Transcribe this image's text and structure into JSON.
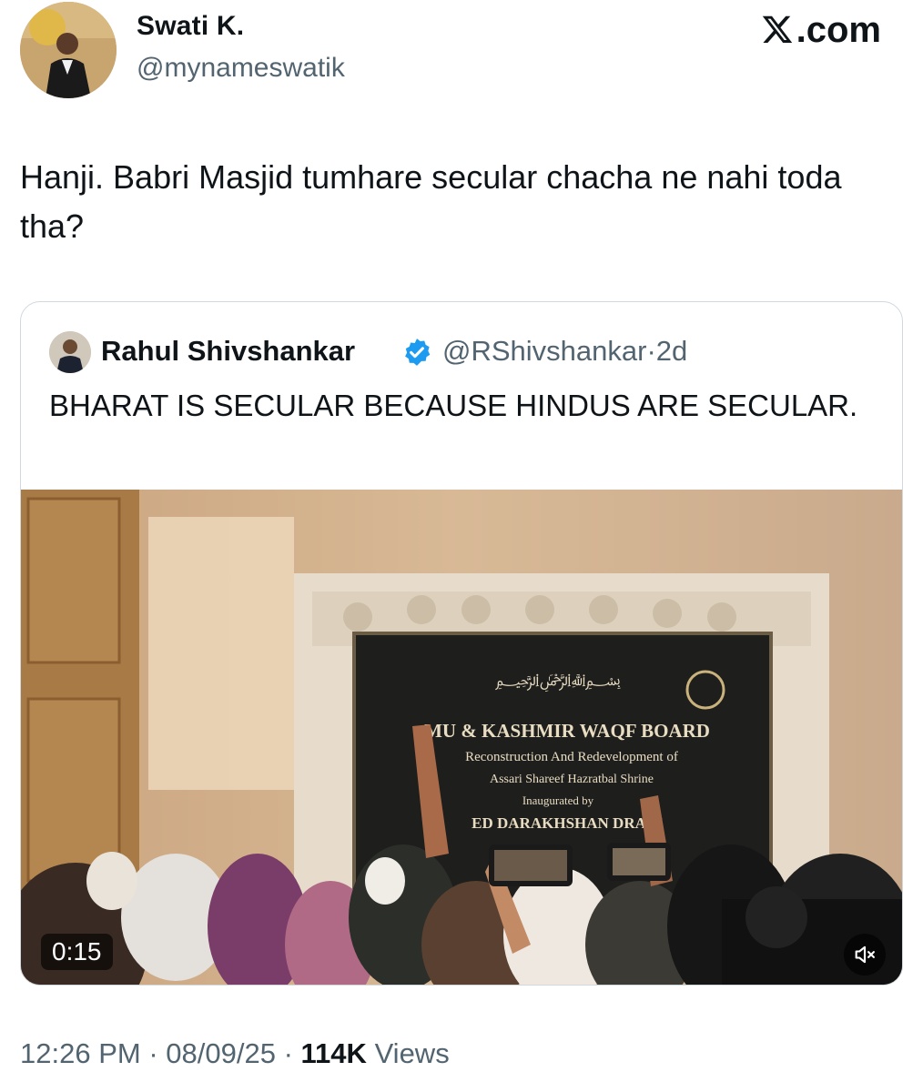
{
  "post": {
    "author_name": "Swati K.",
    "author_handle": "@mynameswatik",
    "brand": ".com",
    "text": "Hanji. Babri Masjid tumhare secular chacha ne nahi toda tha?",
    "time": "12:26 PM",
    "date": "08/09/25",
    "views_count": "114K",
    "views_label": "Views",
    "separator": "·"
  },
  "quote": {
    "author_name": "Rahul Shivshankar",
    "author_handle": "@RShivshankar",
    "age": "2d",
    "text": "BHARAT IS SECULAR BECAUSE HINDUS ARE SECULAR.",
    "video": {
      "duration": "0:15",
      "plaque": {
        "line1": "MU & KASHMIR WAQF BOARD",
        "line2": "Reconstruction And Redevelopment of",
        "line3": "Assari Shareef Hazratbal Shrine",
        "line4": "Inaugurated by",
        "line5": "ED DARAKHSHAN  DRABI"
      }
    }
  },
  "icons": {
    "x_logo": "x-logo-icon",
    "verified": "verified-badge-icon",
    "mute": "speaker-muted-icon"
  },
  "colors": {
    "text": "#0f1419",
    "secondary": "#536471",
    "verified": "#1d9bf0",
    "border": "#cfd9de"
  }
}
